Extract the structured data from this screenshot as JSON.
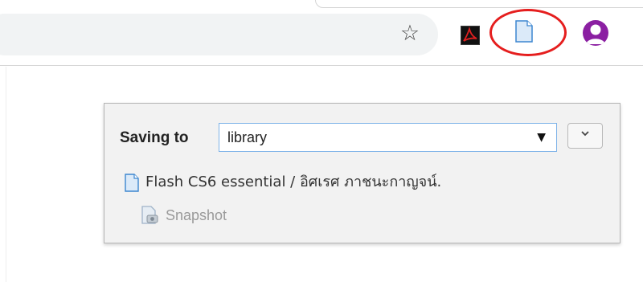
{
  "toolbar": {
    "bookmark_icon": "star-outline-icon",
    "extensions": [
      {
        "name": "Adobe Acrobat",
        "icon": "adobe-acrobat-icon"
      },
      {
        "name": "Zotero Connector",
        "icon": "document-icon"
      }
    ],
    "profile_icon": "avatar-icon",
    "highlight_color": "#e51e1e"
  },
  "popup": {
    "saving_label": "Saving to",
    "collection_value": "library",
    "dropdown_arrow": "▼",
    "options_icon": "chevron-down-icon",
    "item": {
      "title": "Flash CS6 essential / อิศเรศ ภาชนะกาญจน์.",
      "icon": "document-icon"
    },
    "attachment": {
      "label": "Snapshot",
      "icon": "snapshot-icon"
    }
  }
}
